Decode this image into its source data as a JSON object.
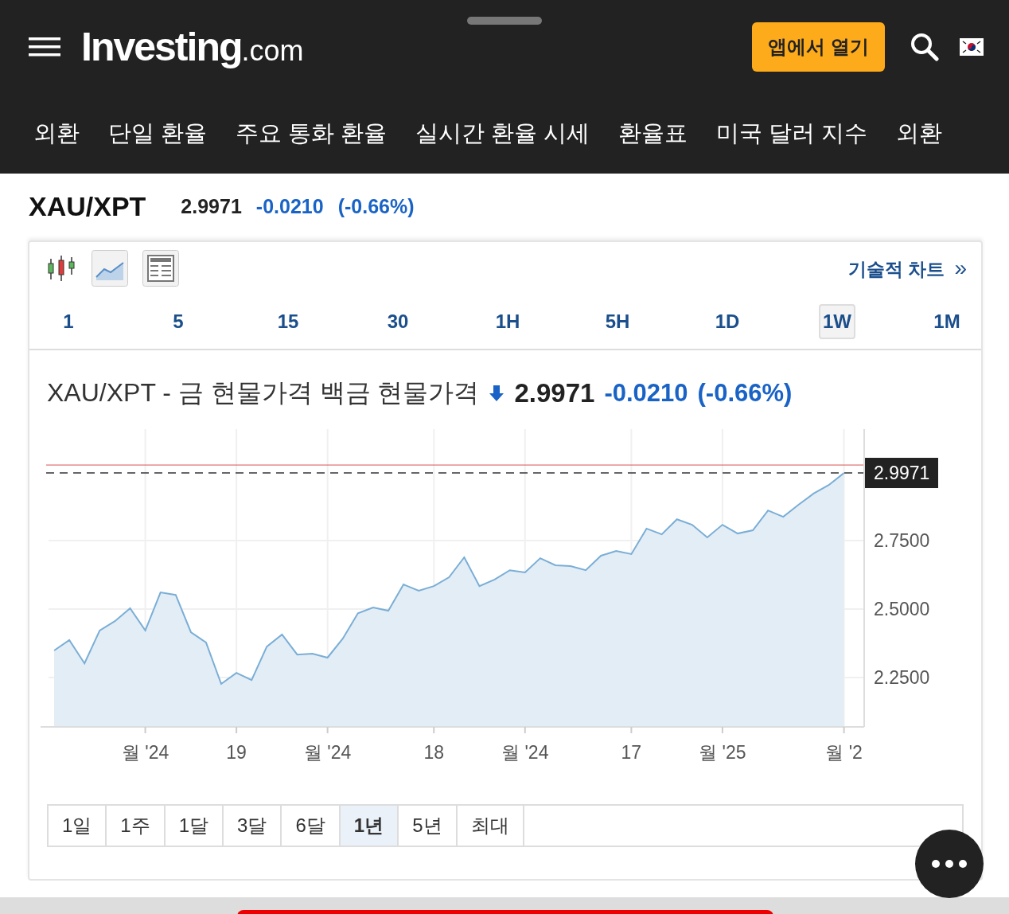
{
  "header": {
    "logo": {
      "name": "Investing",
      "suffix": ".com"
    },
    "open_app_button": "앱에서 열기"
  },
  "nav": {
    "items": [
      "외환",
      "단일 환율",
      "주요 통화 환율",
      "실시간 환율 시세",
      "환율표",
      "미국 달러 지수",
      "외환"
    ]
  },
  "quote": {
    "symbol": "XAU/XPT",
    "price": "2.9971",
    "change": "-0.0210",
    "change_pct": "(-0.66%)"
  },
  "chart_panel": {
    "chart_types": [
      {
        "kind": "candlestick"
      },
      {
        "kind": "area"
      },
      {
        "kind": "table"
      }
    ],
    "tech_chart_link": {
      "label": "기술적 차트",
      "arrow": "»"
    },
    "intervals": [
      {
        "label": "1",
        "selected": false
      },
      {
        "label": "5",
        "selected": false
      },
      {
        "label": "15",
        "selected": false
      },
      {
        "label": "30",
        "selected": false
      },
      {
        "label": "1H",
        "selected": false
      },
      {
        "label": "5H",
        "selected": false
      },
      {
        "label": "1D",
        "selected": false
      },
      {
        "label": "1W",
        "selected": true
      },
      {
        "label": "1M",
        "selected": false
      }
    ],
    "title": {
      "text": "XAU/XPT - 금 현물가격 백금 현물가격",
      "price": "2.9971",
      "change": "-0.0210",
      "change_pct": "(-0.66%)"
    },
    "chart_data": {
      "type": "area",
      "grid": true,
      "categories": [
        null,
        null,
        null,
        null,
        null,
        null,
        "월 '24",
        null,
        null,
        null,
        null,
        null,
        "19",
        null,
        null,
        null,
        null,
        null,
        "월 '24",
        null,
        null,
        null,
        null,
        null,
        null,
        "18",
        null,
        null,
        null,
        null,
        null,
        "월 '24",
        null,
        null,
        null,
        null,
        null,
        null,
        "17",
        null,
        null,
        null,
        null,
        null,
        "월 '25",
        null,
        null,
        null,
        null,
        null,
        null,
        null,
        "월 '2"
      ],
      "ylim": [
        2.07,
        3.157
      ],
      "series": [
        {
          "color": "#7aaed6",
          "values": [
            2.349,
            2.387,
            2.302,
            2.422,
            2.456,
            2.503,
            2.422,
            2.561,
            2.552,
            2.416,
            2.378,
            2.227,
            2.267,
            2.241,
            2.363,
            2.407,
            2.334,
            2.337,
            2.323,
            2.392,
            2.485,
            2.506,
            2.494,
            2.59,
            2.567,
            2.584,
            2.616,
            2.689,
            2.584,
            2.608,
            2.642,
            2.634,
            2.686,
            2.66,
            2.657,
            2.642,
            2.695,
            2.712,
            2.701,
            2.794,
            2.773,
            2.828,
            2.808,
            2.762,
            2.808,
            2.776,
            2.788,
            2.86,
            2.837,
            2.881,
            2.922,
            2.953,
            2.997
          ]
        }
      ],
      "yticks": [
        {
          "value": 2.25,
          "label": "2.2500"
        },
        {
          "value": 2.5,
          "label": "2.5000"
        },
        {
          "value": 2.75,
          "label": "2.7500"
        }
      ],
      "ref_lines": [
        {
          "axis": "y",
          "value": 3.026,
          "color": "#d9534f"
        },
        {
          "axis": "y",
          "value": 2.9971,
          "color": "#333333",
          "label": "2.9971"
        }
      ]
    },
    "ranges": [
      {
        "label": "1일",
        "selected": false
      },
      {
        "label": "1주",
        "selected": false
      },
      {
        "label": "1달",
        "selected": false
      },
      {
        "label": "3달",
        "selected": false
      },
      {
        "label": "6달",
        "selected": false
      },
      {
        "label": "1년",
        "selected": true
      },
      {
        "label": "5년",
        "selected": false
      },
      {
        "label": "최대",
        "selected": false
      }
    ]
  }
}
